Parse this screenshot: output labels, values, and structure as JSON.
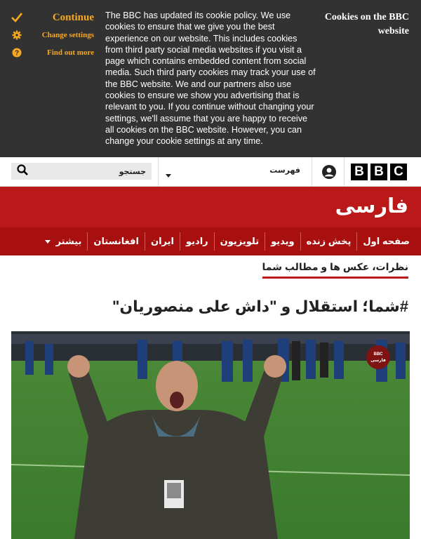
{
  "cookie_banner": {
    "actions": [
      {
        "label": "Continue",
        "icon": "check-icon"
      },
      {
        "label": "Change settings",
        "icon": "gear-icon"
      },
      {
        "label": "Find out more",
        "icon": "question-icon"
      }
    ],
    "message": "The BBC has updated its cookie policy. We use cookies to ensure that we give you the best experience on our website. This includes cookies from third party social media websites if you visit a page which contains embedded content from social media. Such third party cookies may track your use of the BBC website. We and our partners also use cookies to ensure we show you advertising that is relevant to you. If you continue without changing your settings, we'll assume that you are happy to receive all cookies on the BBC website. However, you can change your cookie settings at any time.",
    "title": "Cookies on the BBC website",
    "accent": "#f7a823",
    "background": "#323232"
  },
  "masthead": {
    "search_text": "جستجو",
    "menu_label": "فهرست",
    "logo_letters": [
      "B",
      "B",
      "C"
    ]
  },
  "brand": {
    "name": "فارسی",
    "color": "#bb1919"
  },
  "nav": {
    "items": [
      "صفحه اول",
      "پخش زنده",
      "ویدیو",
      "تلویزیون",
      "رادیو",
      "ایران",
      "افغانستان"
    ],
    "more_label": "بیشتر"
  },
  "article": {
    "section": "نظرات، عکس ها و مطالب شما",
    "headline": "#شما؛ استقلال و \"داش علی منصوریان\"",
    "image_badge": "BBC فارسی"
  }
}
